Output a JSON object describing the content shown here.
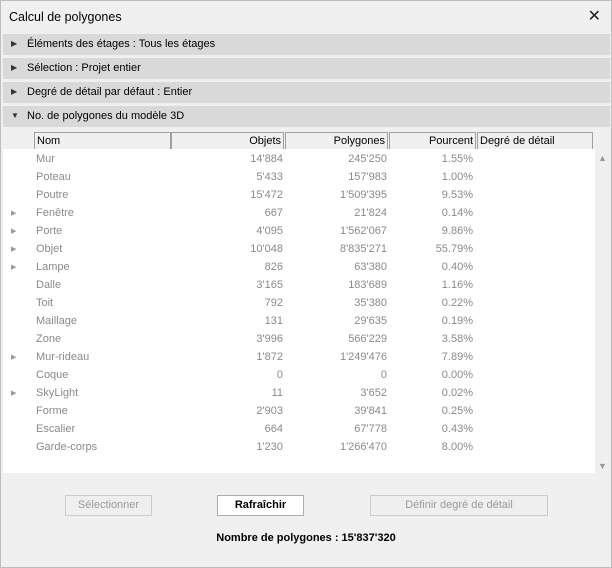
{
  "window": {
    "title": "Calcul de polygones"
  },
  "sections": [
    {
      "label": "Éléments des étages : Tous les étages",
      "expanded": false
    },
    {
      "label": "Sélection : Projet entier",
      "expanded": false
    },
    {
      "label": "Degré de détail par défaut : Entier",
      "expanded": false
    },
    {
      "label": "No. de polygones du modèle 3D",
      "expanded": true
    }
  ],
  "table": {
    "columns": [
      "Nom",
      "Objets",
      "Polygones",
      "Pourcent",
      "Degré de détail"
    ],
    "rows": [
      {
        "nom": "Mur",
        "objets": "14'884",
        "polygones": "245'250",
        "pourcent": "1.55%",
        "expandable": false
      },
      {
        "nom": "Poteau",
        "objets": "5'433",
        "polygones": "157'983",
        "pourcent": "1.00%",
        "expandable": false
      },
      {
        "nom": "Poutre",
        "objets": "15'472",
        "polygones": "1'509'395",
        "pourcent": "9.53%",
        "expandable": false
      },
      {
        "nom": "Fenêtre",
        "objets": "667",
        "polygones": "21'824",
        "pourcent": "0.14%",
        "expandable": true
      },
      {
        "nom": "Porte",
        "objets": "4'095",
        "polygones": "1'562'067",
        "pourcent": "9.86%",
        "expandable": true
      },
      {
        "nom": "Objet",
        "objets": "10'048",
        "polygones": "8'835'271",
        "pourcent": "55.79%",
        "expandable": true
      },
      {
        "nom": "Lampe",
        "objets": "826",
        "polygones": "63'380",
        "pourcent": "0.40%",
        "expandable": true
      },
      {
        "nom": "Dalle",
        "objets": "3'165",
        "polygones": "183'689",
        "pourcent": "1.16%",
        "expandable": false
      },
      {
        "nom": "Toit",
        "objets": "792",
        "polygones": "35'380",
        "pourcent": "0.22%",
        "expandable": false
      },
      {
        "nom": "Maillage",
        "objets": "131",
        "polygones": "29'635",
        "pourcent": "0.19%",
        "expandable": false
      },
      {
        "nom": "Zone",
        "objets": "3'996",
        "polygones": "566'229",
        "pourcent": "3.58%",
        "expandable": false
      },
      {
        "nom": "Mur-rideau",
        "objets": "1'872",
        "polygones": "1'249'476",
        "pourcent": "7.89%",
        "expandable": true
      },
      {
        "nom": "Coque",
        "objets": "0",
        "polygones": "0",
        "pourcent": "0.00%",
        "expandable": false
      },
      {
        "nom": "SkyLight",
        "objets": "11",
        "polygones": "3'652",
        "pourcent": "0.02%",
        "expandable": true
      },
      {
        "nom": "Forme",
        "objets": "2'903",
        "polygones": "39'841",
        "pourcent": "0.25%",
        "expandable": false
      },
      {
        "nom": "Escalier",
        "objets": "664",
        "polygones": "67'778",
        "pourcent": "0.43%",
        "expandable": false
      },
      {
        "nom": "Garde-corps",
        "objets": "1'230",
        "polygones": "1'266'470",
        "pourcent": "8.00%",
        "expandable": false
      }
    ]
  },
  "buttons": {
    "select": "Sélectionner",
    "refresh": "Rafraîchir",
    "set_detail": "Définir degré de détail"
  },
  "total": "Nombre de polygones : 15'837'320"
}
